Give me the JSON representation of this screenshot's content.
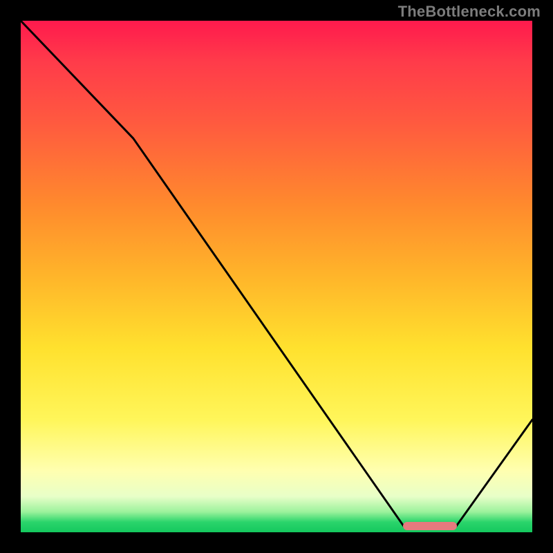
{
  "watermark": "TheBottleneck.com",
  "colors": {
    "frame": "#000000",
    "curve_stroke": "#000000",
    "marker_fill": "#e67a7e",
    "gradient_stops": [
      "#ff1a4d",
      "#ff3b4a",
      "#ff5a3f",
      "#ff8a2d",
      "#ffb52a",
      "#ffe12e",
      "#fff65a",
      "#ffffb0",
      "#e8ffc8",
      "#9cf29c",
      "#2bd46b",
      "#14c85e"
    ]
  },
  "chart_data": {
    "type": "line",
    "title": "",
    "xlabel": "",
    "ylabel": "",
    "xlim": [
      0,
      100
    ],
    "ylim": [
      0,
      100
    ],
    "series": [
      {
        "name": "bottleneck-curve",
        "x": [
          0,
          22,
          75,
          85,
          100
        ],
        "y": [
          100,
          77,
          1,
          1,
          22
        ]
      }
    ],
    "marker": {
      "x_start": 75,
      "x_end": 85,
      "y": 1
    },
    "notes": "No axis ticks, labels, legend, or title are rendered in the source image. Values are normalized to 0–100 in both axes based on pixel positions."
  }
}
